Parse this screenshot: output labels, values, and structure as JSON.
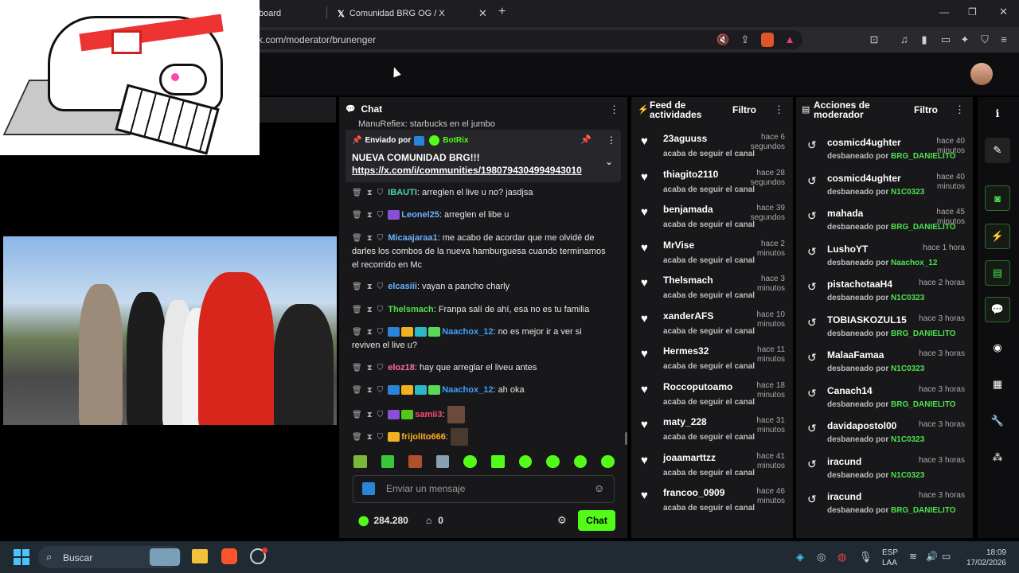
{
  "browser": {
    "tab1": "board",
    "tab2": "Comunidad BRG OG / X",
    "url": "ck.com/moderator/brunenger"
  },
  "chat": {
    "title": "Chat",
    "pinned_by": "Enviado por",
    "pinned_user": "BotRix",
    "pinned_title": "NUEVA COMUNIDAD BRG!!!",
    "pinned_link": "https://x.com/i/communities/1980794304994943010",
    "top_cut": "ManuRefiex: starbucks en el jumbo",
    "messages": [
      {
        "user": "IBAUTI",
        "color": "#4fd1a8",
        "text": ": arreglen el live u no? jasdjsa"
      },
      {
        "user": "Leonel25",
        "color": "#6ab0ff",
        "text": ": arreglen el libe u"
      },
      {
        "user": "Micaajaraa1",
        "color": "#6ab0ff",
        "text": ": me acabo de acordar que me olvidé de darles los combos de la nueva hamburguesa cuando terminamos el recorrido en Mc"
      },
      {
        "user": "elcasiii",
        "color": "#6ab0ff",
        "text": ": vayan a pancho charly"
      },
      {
        "user": "Thelsmach",
        "color": "#4ee04e",
        "text": ": Franpa salí de ahí, esa no es tu familia"
      },
      {
        "user": "Naachox_12",
        "color": "#3da0ff",
        "text": ": no es mejor ir a ver si reviven el live u?"
      },
      {
        "user": "eloz18",
        "color": "#ff6b9e",
        "text": ": hay que arreglar el liveu antes"
      },
      {
        "user": "Naachox_12",
        "color": "#3da0ff",
        "text": ": ah oka"
      },
      {
        "user": "samii3",
        "color": "#ff4a6e",
        "text": ":"
      },
      {
        "user": "frijolito666",
        "color": "#ffb020",
        "text": ":"
      }
    ],
    "placeholder": "Enviar un mensaje",
    "points": "284.280",
    "store": "0",
    "send": "Chat"
  },
  "feed": {
    "title1": "Feed de",
    "title2": "actividades",
    "filter": "Filtro",
    "sub": "acaba de seguir el canal",
    "items": [
      {
        "name": "23aguuss",
        "t1": "hace 6 segundos",
        "t2": ""
      },
      {
        "name": "thiagito2110",
        "t1": "hace 28",
        "t2": "segundos"
      },
      {
        "name": "benjamada",
        "t1": "hace 39",
        "t2": "segundos"
      },
      {
        "name": "MrVise",
        "t1": "hace 2 minutos",
        "t2": ""
      },
      {
        "name": "Thelsmach",
        "t1": "hace 3 minutos",
        "t2": ""
      },
      {
        "name": "xanderAFS",
        "t1": "hace 10 minutos",
        "t2": ""
      },
      {
        "name": "Hermes32",
        "t1": "hace 11 minutos",
        "t2": ""
      },
      {
        "name": "Roccoputoamo",
        "t1": "hace 18",
        "t2": "minutos"
      },
      {
        "name": "maty_228",
        "t1": "hace 31 minutos",
        "t2": ""
      },
      {
        "name": "joaamarttzz",
        "t1": "hace 41 minutos",
        "t2": ""
      },
      {
        "name": "francoo_0909",
        "t1": "hace 46",
        "t2": "minutos"
      }
    ]
  },
  "mod": {
    "title1": "Acciones de",
    "title2": "moderador",
    "filter": "Filtro",
    "by": "desbaneado por",
    "items": [
      {
        "name": "cosmicd4ughter",
        "t1": "hace 40",
        "t2": "minutos",
        "mod": "BRG_DANIELITO"
      },
      {
        "name": "cosmicd4ughter",
        "t1": "hace 40",
        "t2": "minutos",
        "mod": "N1C0323"
      },
      {
        "name": "mahada",
        "t1": "hace 45 minutos",
        "t2": "",
        "mod": "BRG_DANIELITO"
      },
      {
        "name": "LushoYT",
        "t1": "hace 1 hora",
        "t2": "",
        "mod": "Naachox_12"
      },
      {
        "name": "pistachotaaH4",
        "t1": "hace 2 horas",
        "t2": "",
        "mod": "N1C0323"
      },
      {
        "name": "TOBIASKOZUL15",
        "t1": "hace 3 horas",
        "t2": "",
        "mod": "BRG_DANIELITO"
      },
      {
        "name": "MalaaFamaa",
        "t1": "hace 3 horas",
        "t2": "",
        "mod": "N1C0323"
      },
      {
        "name": "Canach14",
        "t1": "hace 3 horas",
        "t2": "",
        "mod": "BRG_DANIELITO"
      },
      {
        "name": "davidapostol00",
        "t1": "hace 3 horas",
        "t2": "",
        "mod": "N1C0323"
      },
      {
        "name": "iracund",
        "t1": "hace 3 horas",
        "t2": "",
        "mod": "N1C0323"
      },
      {
        "name": "iracund",
        "t1": "hace 3 horas",
        "t2": "",
        "mod": "BRG_DANIELITO"
      }
    ]
  },
  "taskbar": {
    "search": "Buscar",
    "lang1": "ESP",
    "lang2": "LAA",
    "time": "18:09",
    "date": "17/02/2026"
  },
  "colors": {
    "accent": "#53fc18",
    "panel": "#18181b"
  }
}
